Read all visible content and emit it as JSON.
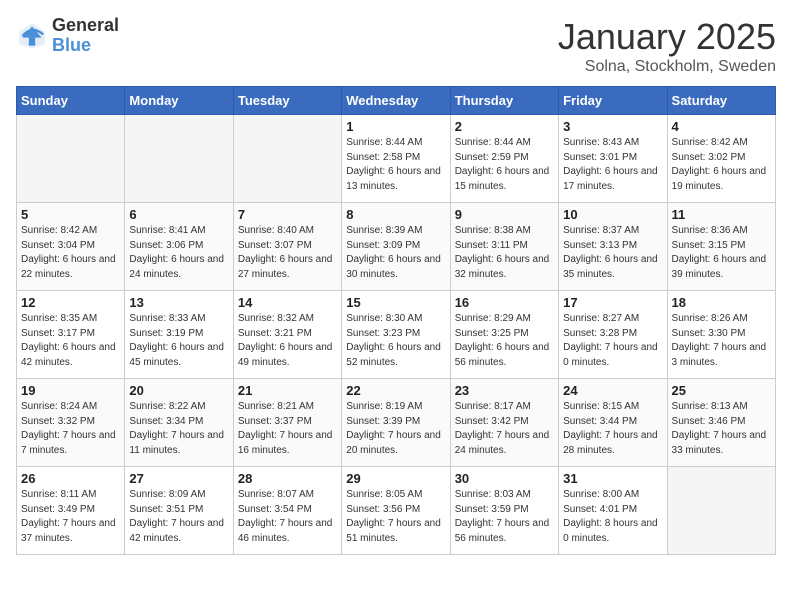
{
  "logo": {
    "general": "General",
    "blue": "Blue"
  },
  "title": "January 2025",
  "subtitle": "Solna, Stockholm, Sweden",
  "weekdays": [
    "Sunday",
    "Monday",
    "Tuesday",
    "Wednesday",
    "Thursday",
    "Friday",
    "Saturday"
  ],
  "weeks": [
    [
      {
        "day": "",
        "sunrise": "",
        "sunset": "",
        "daylight": ""
      },
      {
        "day": "",
        "sunrise": "",
        "sunset": "",
        "daylight": ""
      },
      {
        "day": "",
        "sunrise": "",
        "sunset": "",
        "daylight": ""
      },
      {
        "day": "1",
        "sunrise": "Sunrise: 8:44 AM",
        "sunset": "Sunset: 2:58 PM",
        "daylight": "Daylight: 6 hours and 13 minutes."
      },
      {
        "day": "2",
        "sunrise": "Sunrise: 8:44 AM",
        "sunset": "Sunset: 2:59 PM",
        "daylight": "Daylight: 6 hours and 15 minutes."
      },
      {
        "day": "3",
        "sunrise": "Sunrise: 8:43 AM",
        "sunset": "Sunset: 3:01 PM",
        "daylight": "Daylight: 6 hours and 17 minutes."
      },
      {
        "day": "4",
        "sunrise": "Sunrise: 8:42 AM",
        "sunset": "Sunset: 3:02 PM",
        "daylight": "Daylight: 6 hours and 19 minutes."
      }
    ],
    [
      {
        "day": "5",
        "sunrise": "Sunrise: 8:42 AM",
        "sunset": "Sunset: 3:04 PM",
        "daylight": "Daylight: 6 hours and 22 minutes."
      },
      {
        "day": "6",
        "sunrise": "Sunrise: 8:41 AM",
        "sunset": "Sunset: 3:06 PM",
        "daylight": "Daylight: 6 hours and 24 minutes."
      },
      {
        "day": "7",
        "sunrise": "Sunrise: 8:40 AM",
        "sunset": "Sunset: 3:07 PM",
        "daylight": "Daylight: 6 hours and 27 minutes."
      },
      {
        "day": "8",
        "sunrise": "Sunrise: 8:39 AM",
        "sunset": "Sunset: 3:09 PM",
        "daylight": "Daylight: 6 hours and 30 minutes."
      },
      {
        "day": "9",
        "sunrise": "Sunrise: 8:38 AM",
        "sunset": "Sunset: 3:11 PM",
        "daylight": "Daylight: 6 hours and 32 minutes."
      },
      {
        "day": "10",
        "sunrise": "Sunrise: 8:37 AM",
        "sunset": "Sunset: 3:13 PM",
        "daylight": "Daylight: 6 hours and 35 minutes."
      },
      {
        "day": "11",
        "sunrise": "Sunrise: 8:36 AM",
        "sunset": "Sunset: 3:15 PM",
        "daylight": "Daylight: 6 hours and 39 minutes."
      }
    ],
    [
      {
        "day": "12",
        "sunrise": "Sunrise: 8:35 AM",
        "sunset": "Sunset: 3:17 PM",
        "daylight": "Daylight: 6 hours and 42 minutes."
      },
      {
        "day": "13",
        "sunrise": "Sunrise: 8:33 AM",
        "sunset": "Sunset: 3:19 PM",
        "daylight": "Daylight: 6 hours and 45 minutes."
      },
      {
        "day": "14",
        "sunrise": "Sunrise: 8:32 AM",
        "sunset": "Sunset: 3:21 PM",
        "daylight": "Daylight: 6 hours and 49 minutes."
      },
      {
        "day": "15",
        "sunrise": "Sunrise: 8:30 AM",
        "sunset": "Sunset: 3:23 PM",
        "daylight": "Daylight: 6 hours and 52 minutes."
      },
      {
        "day": "16",
        "sunrise": "Sunrise: 8:29 AM",
        "sunset": "Sunset: 3:25 PM",
        "daylight": "Daylight: 6 hours and 56 minutes."
      },
      {
        "day": "17",
        "sunrise": "Sunrise: 8:27 AM",
        "sunset": "Sunset: 3:28 PM",
        "daylight": "Daylight: 7 hours and 0 minutes."
      },
      {
        "day": "18",
        "sunrise": "Sunrise: 8:26 AM",
        "sunset": "Sunset: 3:30 PM",
        "daylight": "Daylight: 7 hours and 3 minutes."
      }
    ],
    [
      {
        "day": "19",
        "sunrise": "Sunrise: 8:24 AM",
        "sunset": "Sunset: 3:32 PM",
        "daylight": "Daylight: 7 hours and 7 minutes."
      },
      {
        "day": "20",
        "sunrise": "Sunrise: 8:22 AM",
        "sunset": "Sunset: 3:34 PM",
        "daylight": "Daylight: 7 hours and 11 minutes."
      },
      {
        "day": "21",
        "sunrise": "Sunrise: 8:21 AM",
        "sunset": "Sunset: 3:37 PM",
        "daylight": "Daylight: 7 hours and 16 minutes."
      },
      {
        "day": "22",
        "sunrise": "Sunrise: 8:19 AM",
        "sunset": "Sunset: 3:39 PM",
        "daylight": "Daylight: 7 hours and 20 minutes."
      },
      {
        "day": "23",
        "sunrise": "Sunrise: 8:17 AM",
        "sunset": "Sunset: 3:42 PM",
        "daylight": "Daylight: 7 hours and 24 minutes."
      },
      {
        "day": "24",
        "sunrise": "Sunrise: 8:15 AM",
        "sunset": "Sunset: 3:44 PM",
        "daylight": "Daylight: 7 hours and 28 minutes."
      },
      {
        "day": "25",
        "sunrise": "Sunrise: 8:13 AM",
        "sunset": "Sunset: 3:46 PM",
        "daylight": "Daylight: 7 hours and 33 minutes."
      }
    ],
    [
      {
        "day": "26",
        "sunrise": "Sunrise: 8:11 AM",
        "sunset": "Sunset: 3:49 PM",
        "daylight": "Daylight: 7 hours and 37 minutes."
      },
      {
        "day": "27",
        "sunrise": "Sunrise: 8:09 AM",
        "sunset": "Sunset: 3:51 PM",
        "daylight": "Daylight: 7 hours and 42 minutes."
      },
      {
        "day": "28",
        "sunrise": "Sunrise: 8:07 AM",
        "sunset": "Sunset: 3:54 PM",
        "daylight": "Daylight: 7 hours and 46 minutes."
      },
      {
        "day": "29",
        "sunrise": "Sunrise: 8:05 AM",
        "sunset": "Sunset: 3:56 PM",
        "daylight": "Daylight: 7 hours and 51 minutes."
      },
      {
        "day": "30",
        "sunrise": "Sunrise: 8:03 AM",
        "sunset": "Sunset: 3:59 PM",
        "daylight": "Daylight: 7 hours and 56 minutes."
      },
      {
        "day": "31",
        "sunrise": "Sunrise: 8:00 AM",
        "sunset": "Sunset: 4:01 PM",
        "daylight": "Daylight: 8 hours and 0 minutes."
      },
      {
        "day": "",
        "sunrise": "",
        "sunset": "",
        "daylight": ""
      }
    ]
  ]
}
